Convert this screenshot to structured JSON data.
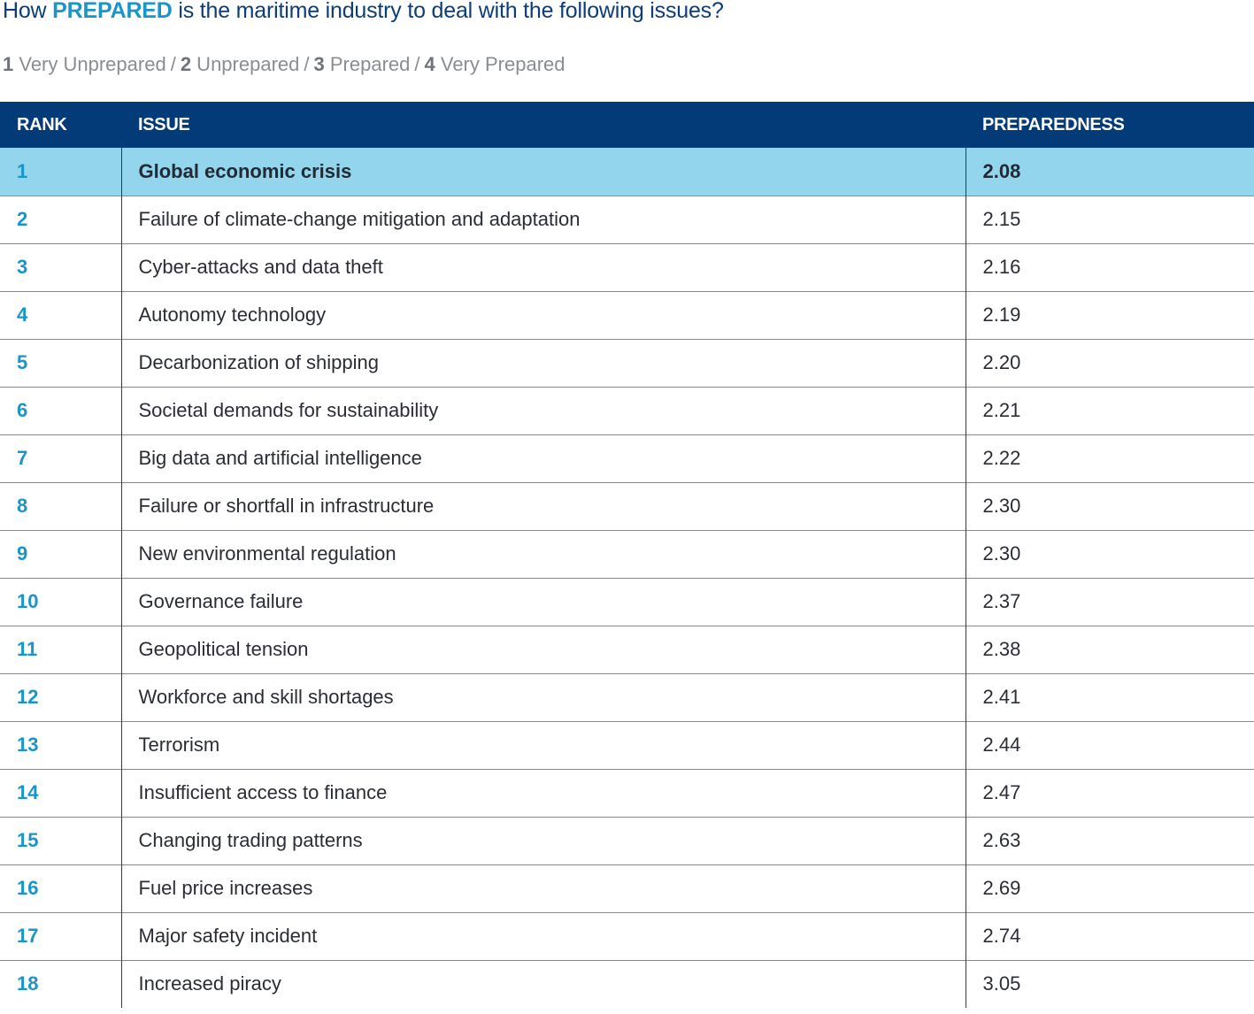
{
  "title": {
    "prefix": "How ",
    "highlight": "PREPARED",
    "suffix": " is the maritime industry to deal with the following issues?"
  },
  "scale": [
    {
      "num": "1",
      "label": " Very Unprepared"
    },
    {
      "num": "2",
      "label": " Unprepared"
    },
    {
      "num": "3",
      "label": " Prepared"
    },
    {
      "num": "4",
      "label": " Very Prepared"
    }
  ],
  "scale_separator": "/",
  "table": {
    "headers": {
      "rank": "RANK",
      "issue": "ISSUE",
      "preparedness": "PREPAREDNESS"
    },
    "rows": [
      {
        "rank": "1",
        "issue": "Global economic crisis",
        "preparedness": "2.08",
        "highlight": true
      },
      {
        "rank": "2",
        "issue": "Failure of climate-change mitigation and adaptation",
        "preparedness": "2.15"
      },
      {
        "rank": "3",
        "issue": "Cyber-attacks and data theft",
        "preparedness": "2.16"
      },
      {
        "rank": "4",
        "issue": "Autonomy technology",
        "preparedness": "2.19"
      },
      {
        "rank": "5",
        "issue": "Decarbonization of shipping",
        "preparedness": "2.20"
      },
      {
        "rank": "6",
        "issue": "Societal demands for sustainability",
        "preparedness": "2.21"
      },
      {
        "rank": "7",
        "issue": "Big data and artificial intelligence",
        "preparedness": "2.22"
      },
      {
        "rank": "8",
        "issue": "Failure or shortfall in infrastructure",
        "preparedness": "2.30"
      },
      {
        "rank": "9",
        "issue": "New environmental regulation",
        "preparedness": "2.30"
      },
      {
        "rank": "10",
        "issue": "Governance failure",
        "preparedness": "2.37"
      },
      {
        "rank": "11",
        "issue": "Geopolitical tension",
        "preparedness": "2.38"
      },
      {
        "rank": "12",
        "issue": "Workforce and skill shortages",
        "preparedness": "2.41"
      },
      {
        "rank": "13",
        "issue": "Terrorism",
        "preparedness": "2.44"
      },
      {
        "rank": "14",
        "issue": "Insufficient access to finance",
        "preparedness": "2.47"
      },
      {
        "rank": "15",
        "issue": "Changing trading patterns",
        "preparedness": "2.63"
      },
      {
        "rank": "16",
        "issue": "Fuel price increases",
        "preparedness": "2.69"
      },
      {
        "rank": "17",
        "issue": "Major safety incident",
        "preparedness": "2.74"
      },
      {
        "rank": "18",
        "issue": "Increased piracy",
        "preparedness": "3.05"
      }
    ]
  },
  "colors": {
    "header_bg": "#033a78",
    "highlight_row_bg": "#92d5ec",
    "accent_blue": "#1a95c8",
    "title_navy": "#0d3d79"
  }
}
